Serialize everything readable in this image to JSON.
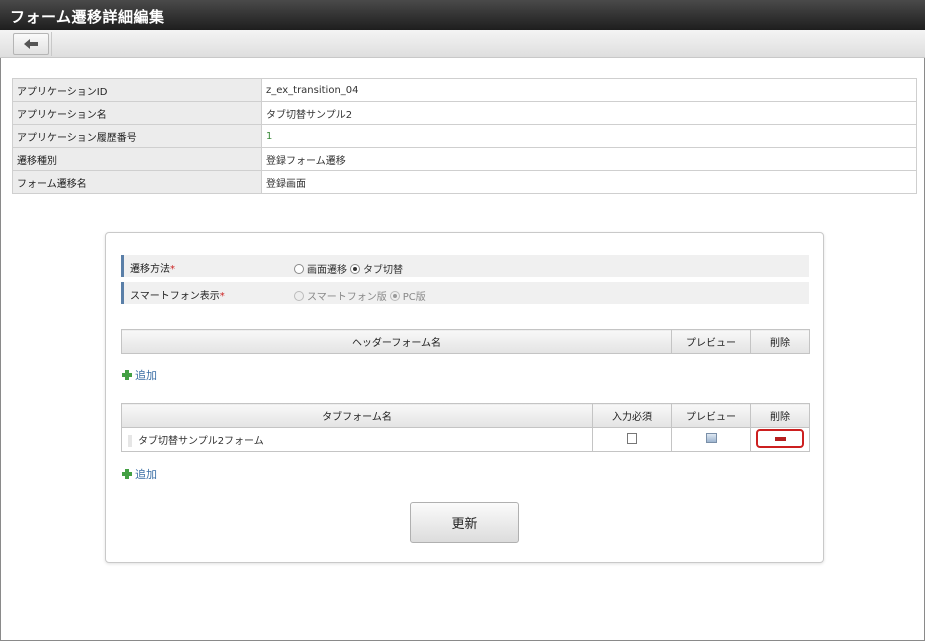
{
  "window": {
    "title": "フォーム遷移詳細編集"
  },
  "toolbar": {
    "back_icon": "arrow-left-icon"
  },
  "info": [
    {
      "label": "アプリケーションID",
      "value": "z_ex_transition_04"
    },
    {
      "label": "アプリケーション名",
      "value": "タブ切替サンプル2"
    },
    {
      "label": "アプリケーション履歴番号",
      "value": "1"
    },
    {
      "label": "遷移種別",
      "value": "登録フォーム遷移"
    },
    {
      "label": "フォーム遷移名",
      "value": "登録画面"
    }
  ],
  "form": {
    "method": {
      "label": "遷移方法",
      "required_mark": "*",
      "options": [
        "画面遷移",
        "タブ切替"
      ],
      "selected": "タブ切替"
    },
    "smartphone": {
      "label": "スマートフォン表示",
      "required_mark": "*",
      "options": [
        "スマートフォン版",
        "PC版"
      ],
      "selected": "PC版",
      "disabled": true
    }
  },
  "header_table": {
    "columns": [
      "ヘッダーフォーム名",
      "プレビュー",
      "削除"
    ],
    "add_label": "追加"
  },
  "tab_table": {
    "columns": [
      "タブフォーム名",
      "入力必須",
      "プレビュー",
      "削除"
    ],
    "rows": [
      {
        "name": "タブ切替サンプル2フォーム",
        "required": false
      }
    ],
    "add_label": "追加"
  },
  "update_label": "更新",
  "colors": {
    "highlight": "#cc1f1f",
    "titlebar": "#2b2b2b",
    "link": "#3a6ea5"
  }
}
